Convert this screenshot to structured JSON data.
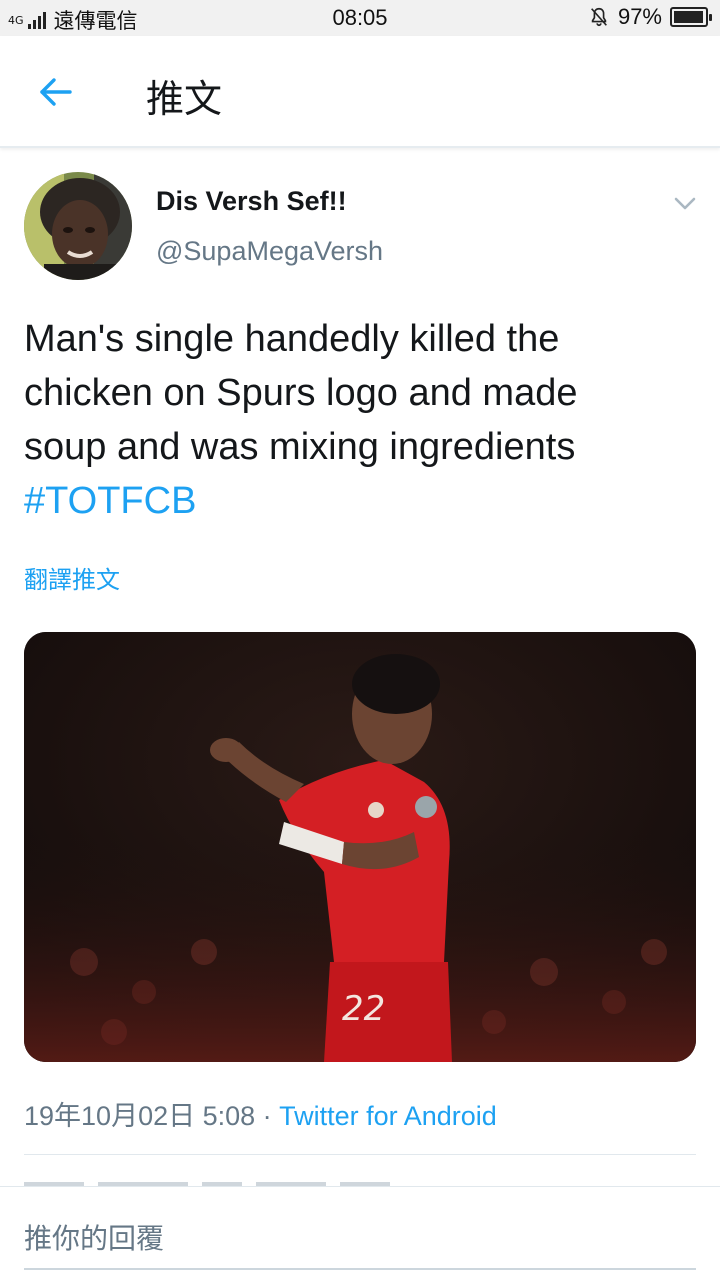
{
  "status_bar": {
    "network": "4G",
    "carrier": "遠傳電信",
    "time": "08:05",
    "battery": "97%",
    "battery_level": 0.97
  },
  "header": {
    "back_icon": "arrow-left-icon",
    "title": "推文"
  },
  "tweet": {
    "author_name": "Dis Versh Sef!!",
    "author_handle": "@SupaMegaVersh",
    "text_line1": "Man's single handedly killed the",
    "text_line2": "chicken on Spurs logo and made",
    "text_line3": "soup and was mixing ingredients",
    "hashtag": "#TOTFCB",
    "translate_label": "翻譯推文",
    "timestamp": "19年10月02日 5:08",
    "separator": " · ",
    "source": "Twitter for Android"
  },
  "reply": {
    "placeholder": "推你的回覆"
  },
  "colors": {
    "accent": "#1da1f2",
    "secondary_text": "#657786",
    "primary_text": "#14171a"
  }
}
